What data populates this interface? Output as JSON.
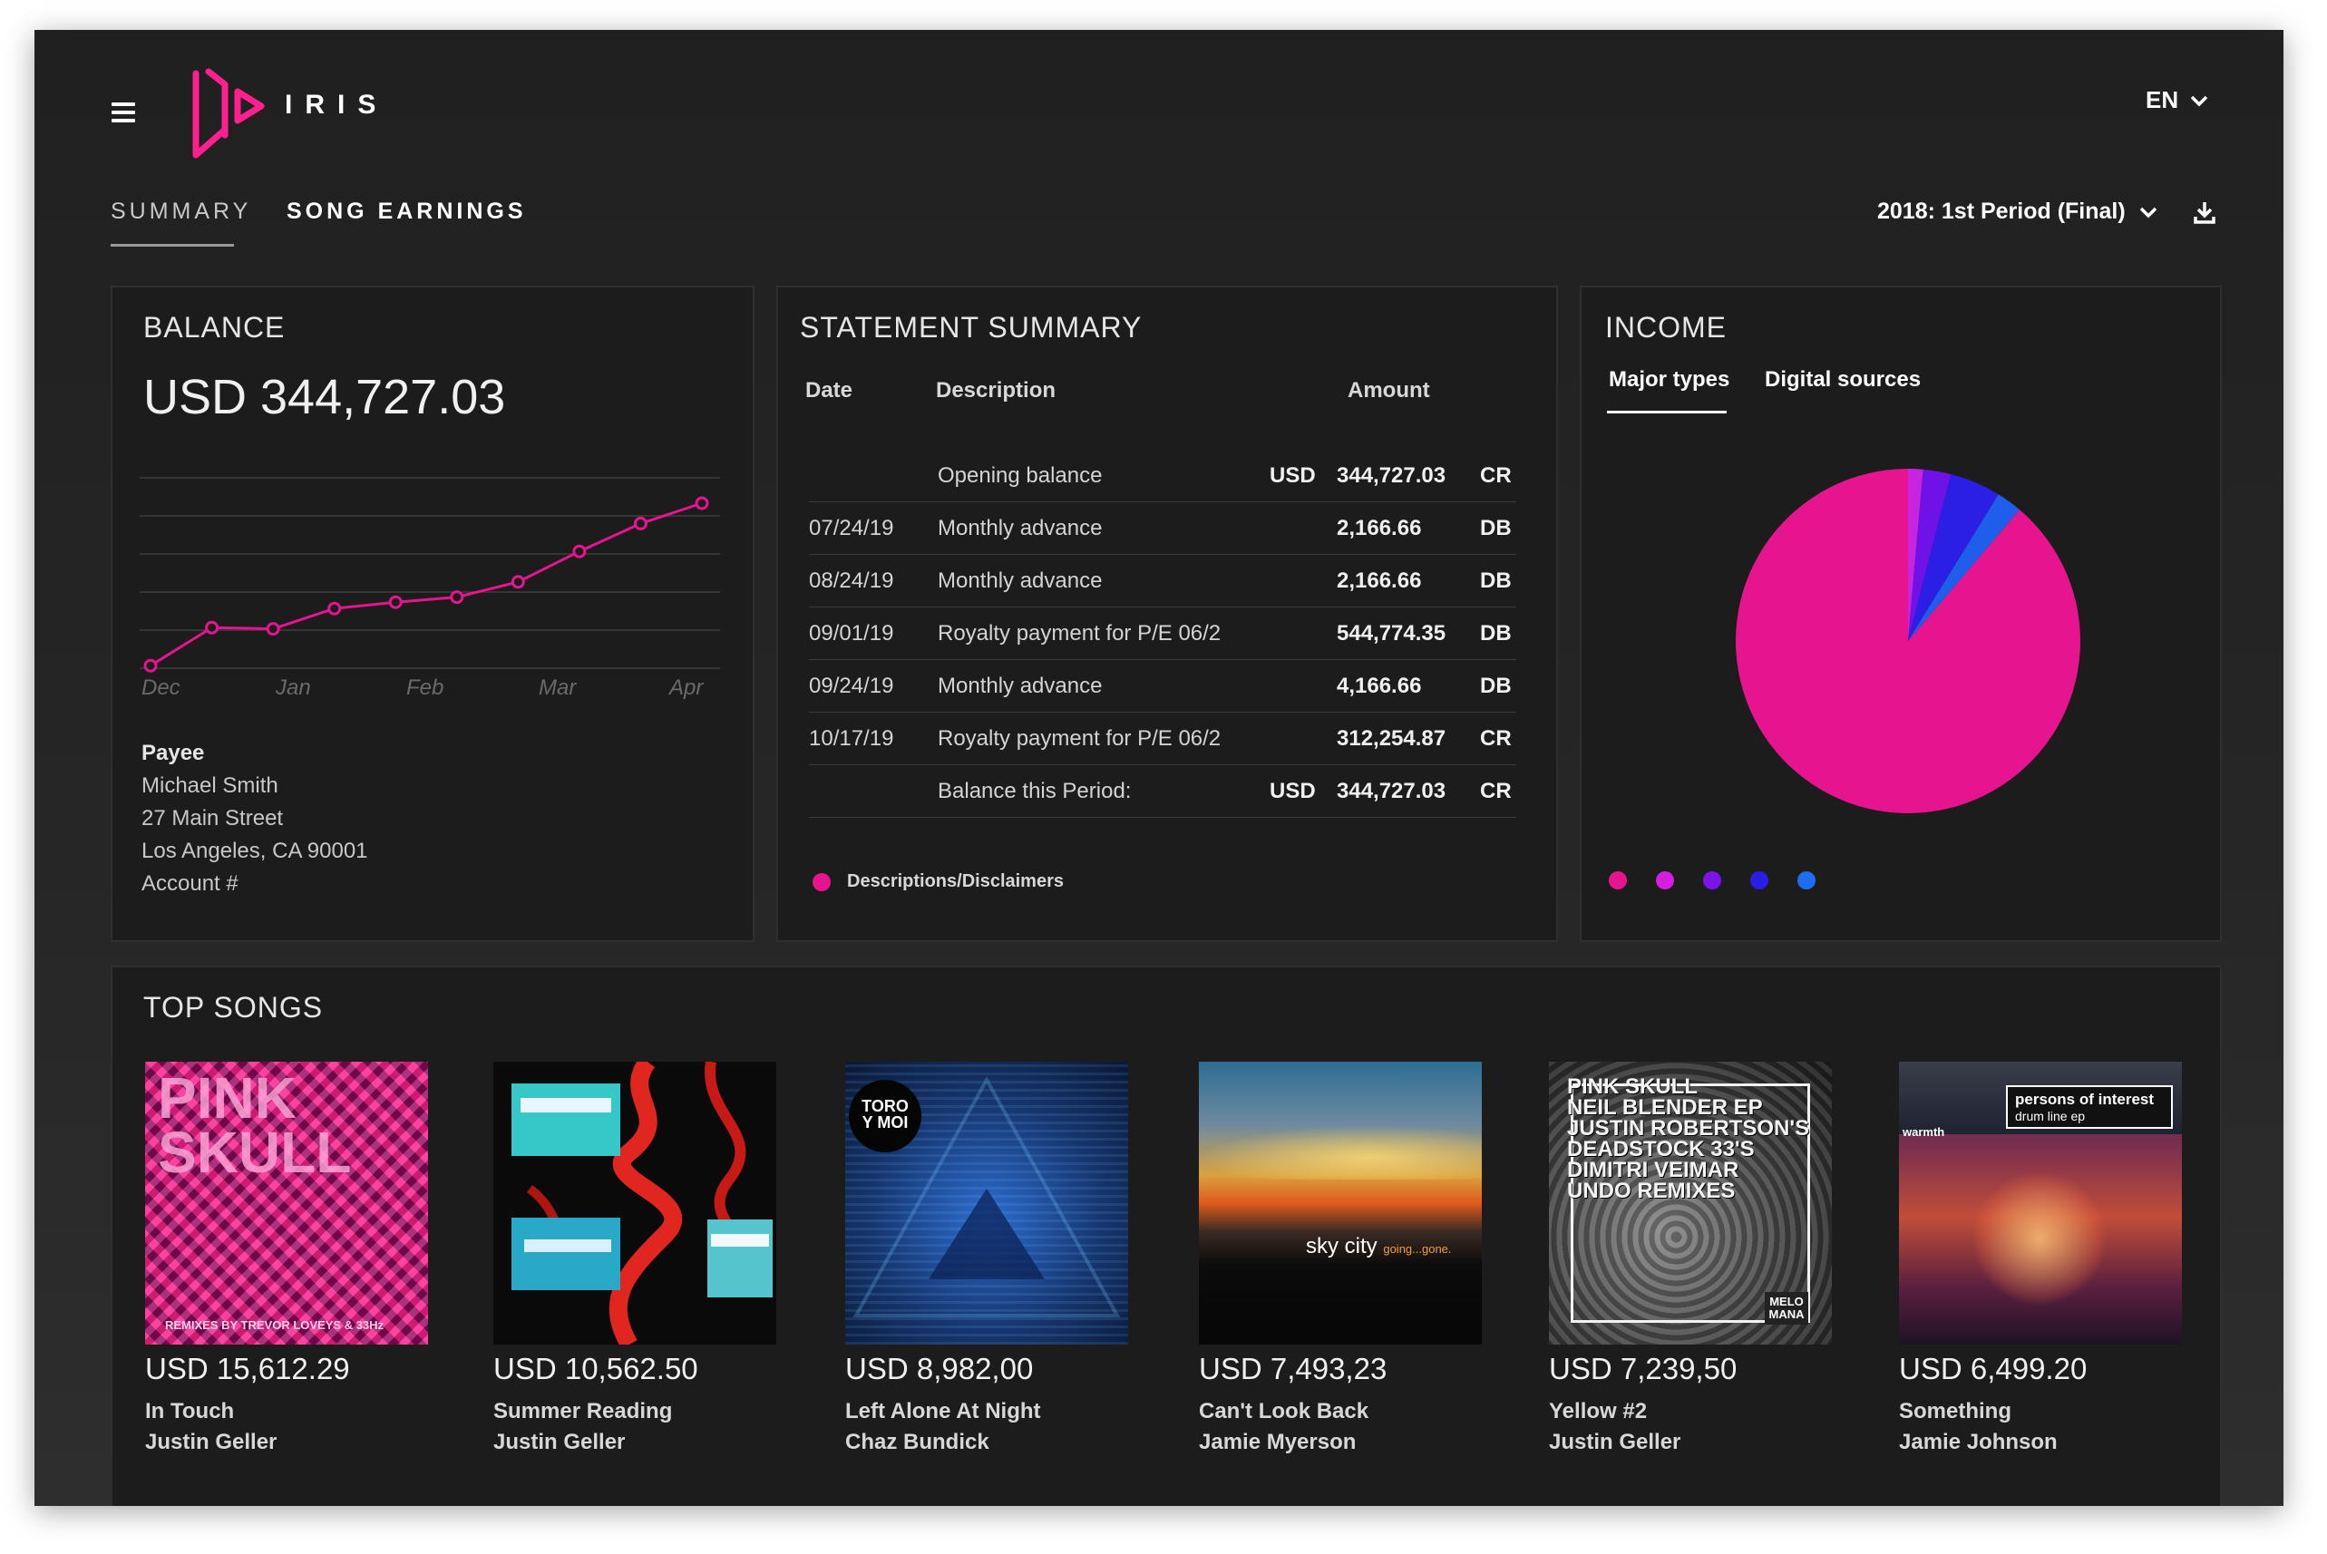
{
  "brand": {
    "name": "IRIS",
    "logo": "iris-logo"
  },
  "header": {
    "menu_icon": "hamburger-icon",
    "language": "EN",
    "language_icon": "chevron-down-icon"
  },
  "nav": {
    "tabs": [
      {
        "label": "SUMMARY",
        "active": true
      },
      {
        "label": "SONG EARNINGS",
        "active": false
      }
    ],
    "period": "2018: 1st Period (Final)",
    "period_icon": "chevron-down-icon",
    "download_icon": "download-icon"
  },
  "balance": {
    "title": "BALANCE",
    "amount": "USD 344,727.03",
    "chart_data": {
      "type": "line",
      "x": [
        "Dec",
        "",
        "",
        "Jan",
        "",
        "Feb",
        "",
        "Mar",
        "",
        "Apr"
      ],
      "months": [
        "Dec",
        "Jan",
        "Feb",
        "Mar",
        "Apr"
      ],
      "values": [
        2,
        32,
        31,
        47,
        52,
        56,
        68,
        92,
        114,
        130
      ],
      "ylim": [
        0,
        150
      ],
      "color": "#e6158f",
      "grid": true
    },
    "payee": {
      "label": "Payee",
      "name": "Michael Smith",
      "street": "27 Main Street",
      "city": "Los Angeles, CA 90001",
      "account": "Account #"
    }
  },
  "statement": {
    "title": "STATEMENT SUMMARY",
    "columns": {
      "date": "Date",
      "description": "Description",
      "amount": "Amount"
    },
    "rows": [
      {
        "date": "",
        "description": "Opening balance",
        "currency": "USD",
        "amount": "344,727.03",
        "flag": "CR"
      },
      {
        "date": "07/24/19",
        "description": "Monthly advance",
        "currency": "",
        "amount": "2,166.66",
        "flag": "DB"
      },
      {
        "date": "08/24/19",
        "description": "Monthly advance",
        "currency": "",
        "amount": "2,166.66",
        "flag": "DB"
      },
      {
        "date": "09/01/19",
        "description": "Royalty payment for P/E 06/2",
        "currency": "",
        "amount": "544,774.35",
        "flag": "DB"
      },
      {
        "date": "09/24/19",
        "description": "Monthly advance",
        "currency": "",
        "amount": "4,166.66",
        "flag": "DB"
      },
      {
        "date": "10/17/19",
        "description": "Royalty payment for P/E 06/2",
        "currency": "",
        "amount": "312,254.87",
        "flag": "CR"
      },
      {
        "date": "",
        "description": "Balance this Period:",
        "currency": "USD",
        "amount": "344,727.03",
        "flag": "CR"
      }
    ],
    "disclaimer": "Descriptions/Disclaimers",
    "disclaimer_color": "#e6158f"
  },
  "income": {
    "title": "INCOME",
    "tabs": [
      {
        "label": "Major types",
        "active": true
      },
      {
        "label": "Digital sources",
        "active": false
      }
    ],
    "chart_data": {
      "type": "pie",
      "values": [
        88.8,
        1.4,
        2.6,
        4.8,
        2.4
      ],
      "colors": [
        "#e6158f",
        "#c724e0",
        "#6e12e8",
        "#2b1fe6",
        "#1f5eea"
      ]
    },
    "legend_colors": [
      "#e6158f",
      "#d51fe0",
      "#7a14ea",
      "#2a1ee6",
      "#1f6cf0"
    ]
  },
  "top_songs": {
    "title": "TOP SONGS",
    "items": [
      {
        "amount": "USD 15,612.29",
        "title": "In Touch",
        "artist": "Justin Geller",
        "cover_text": [
          "PINK",
          "SKULL",
          "REMIXES BY TREVOR LOVEYS & 33Hz"
        ]
      },
      {
        "amount": "USD 10,562.50",
        "title": "Summer Reading",
        "artist": "Justin Geller"
      },
      {
        "amount": "USD 8,982,00",
        "title": "Left Alone At Night",
        "artist": "Chaz Bundick",
        "cover_text": [
          "TORO",
          "Y MOI"
        ]
      },
      {
        "amount": "USD 7,493,23",
        "title": "Can't Look Back",
        "artist": "Jamie Myerson",
        "cover_text": [
          "sky city",
          "going...gone."
        ]
      },
      {
        "amount": "USD 7,239,50",
        "title": "Yellow #2",
        "artist": "Justin Geller",
        "cover_text": [
          "PINK SKULL",
          "NEIL BLENDER EP",
          "JUSTIN ROBERTSON'S",
          "DEADSTOCK 33'S",
          "DIMITRI VEIMAR",
          "UNDO REMIXES",
          "MELO",
          "MANA"
        ]
      },
      {
        "amount": "USD 6,499.20",
        "title": "Something",
        "artist": "Jamie Johnson",
        "cover_text": [
          "persons of interest",
          "drum line ep",
          "warmth"
        ]
      }
    ]
  }
}
